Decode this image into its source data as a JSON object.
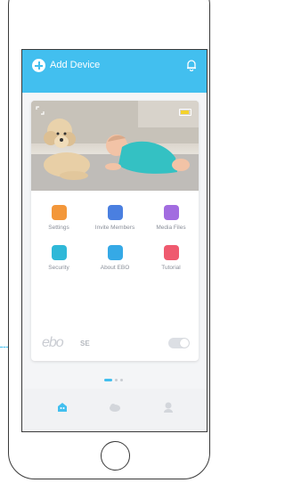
{
  "header": {
    "add_device_label": "Add Device"
  },
  "device_card": {
    "menu": [
      {
        "label": "Settings",
        "color": "#f3973a",
        "icon": "settings-icon"
      },
      {
        "label": "Invite Members",
        "color": "#4a7fe0",
        "icon": "invite-members-icon"
      },
      {
        "label": "Media Files",
        "color": "#a26ce0",
        "icon": "media-files-icon"
      },
      {
        "label": "Security",
        "color": "#2fb8d8",
        "icon": "security-icon"
      },
      {
        "label": "About EBO",
        "color": "#35a9e6",
        "icon": "about-icon"
      },
      {
        "label": "Tutorial",
        "color": "#ef5a6f",
        "icon": "tutorial-icon"
      }
    ],
    "brand_logo": "ebo",
    "model": "SE"
  },
  "colors": {
    "accent": "#42bfef"
  }
}
